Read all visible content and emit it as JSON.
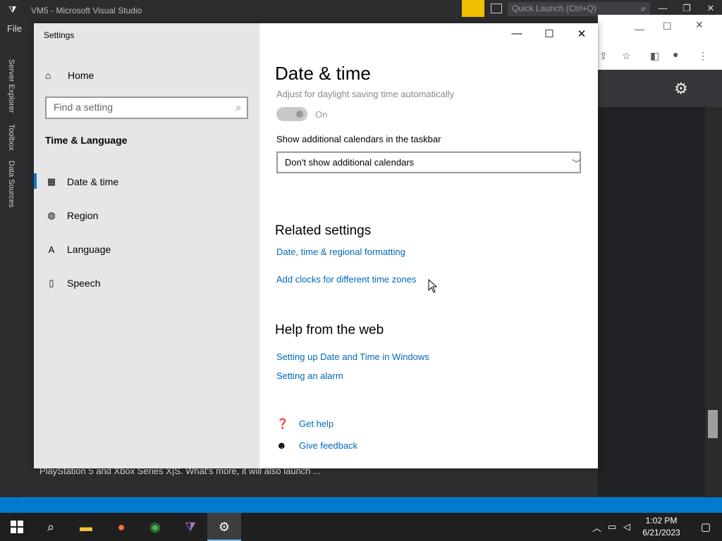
{
  "background_app": {
    "title": "VM5 - Microsoft Visual Studio",
    "quick_launch_placeholder": "Quick Launch (Ctrl+Q)",
    "menu_file": "File",
    "side_tabs": [
      "Server Explorer",
      "Toolbox",
      "Data Sources"
    ],
    "bottom_text": "PlayStation 5 and Xbox Series X|S. What's more, it will also launch ..."
  },
  "settings": {
    "app_title": "Settings",
    "nav": {
      "home": "Home",
      "search_placeholder": "Find a setting",
      "section": "Time & Language",
      "items": [
        {
          "label": "Date & time",
          "icon": "calendar-clock-icon",
          "active": true
        },
        {
          "label": "Region",
          "icon": "globe-icon",
          "active": false
        },
        {
          "label": "Language",
          "icon": "language-icon",
          "active": false
        },
        {
          "label": "Speech",
          "icon": "microphone-icon",
          "active": false
        }
      ]
    },
    "page": {
      "title": "Date & time",
      "dst_label": "Adjust for daylight saving time automatically",
      "dst_toggle_state": "On",
      "calendars_label": "Show additional calendars in the taskbar",
      "calendars_value": "Don't show additional calendars",
      "related_heading": "Related settings",
      "related_links": [
        "Date, time & regional formatting",
        "Add clocks for different time zones"
      ],
      "help_heading": "Help from the web",
      "help_links": [
        "Setting up Date and Time in Windows",
        "Setting an alarm"
      ],
      "get_help": "Get help",
      "give_feedback": "Give feedback"
    }
  },
  "taskbar": {
    "time": "1:02 PM",
    "date": "6/21/2023",
    "apps": [
      "start-icon",
      "search-icon",
      "file-explorer-icon",
      "firefox-icon",
      "chrome-icon",
      "visual-studio-icon",
      "settings-icon"
    ]
  },
  "colors": {
    "link": "#0067b8",
    "accent": "#0078d7",
    "nav_bg": "#e6e6e6"
  }
}
